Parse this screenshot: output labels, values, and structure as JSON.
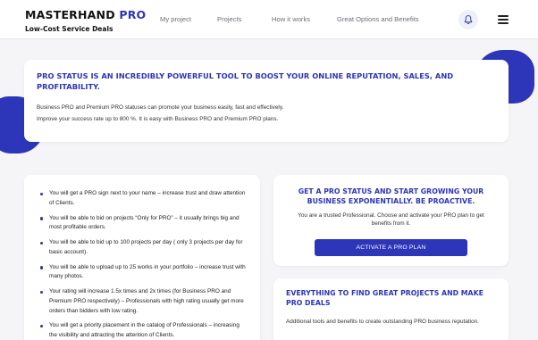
{
  "header": {
    "brand_name": "MASTERHAND",
    "brand_accent": "PRO",
    "brand_subtitle": "Low-Cost Service Deals",
    "nav": [
      {
        "label": "My project"
      },
      {
        "label": "Projects"
      },
      {
        "label": "How it works"
      },
      {
        "label": "Great Options and Benefits"
      }
    ],
    "icons": {
      "notifications": "bell-icon",
      "menu": "hamburger-menu-icon"
    }
  },
  "colors": {
    "accent": "#2d35b8",
    "background": "#f5f5f7",
    "card": "#ffffff"
  },
  "intro": {
    "title": "PRO STATUS IS AN INCREDIBLY POWERFUL TOOL TO BOOST YOUR ONLINE REPUTATION, SALES, AND PROFITABILITY.",
    "text1": "Business PRO and Premium PRO statuses can promote your business easily, fast and effectively.",
    "text2": "Improve your success rate up to 800 %. It is easy with Business PRO and Premium PRO plans."
  },
  "benefits": [
    "You will get a PRO sign next to your name – increase trust and draw attention of Clients.",
    "You will be able to bid on projects “Only for PRO” – it usually brings big and most profitable orders.",
    "You will be able to bid up to 100 projects per day ( only 3 projects per day for basic account).",
    "You will be able to upload up to 25 works in your portfolio – increase trust with many photos.",
    "Your rating will increase 1.5x times and 2x times (for Business PRO and Premium PRO respectively) – Professionals with high rating usually get more orders than bidders with low rating.",
    "You will get a priority placement in the catalog of Professionals – increasing the visibility and attracting the attention of Clients."
  ],
  "cta": {
    "title": "GET A PRO STATUS AND START GROWING YOUR BUSINESS EXPONENTIALLY. BE PROACTIVE.",
    "text": "You are a trusted Professional. Choose and activate your PRO plan to get benefits from it.",
    "button": "ACTIVATE A PRO PLAN"
  },
  "tools": {
    "title": "EVERYTHING TO FIND GREAT PROJECTS AND MAKE PRO DEALS",
    "text": "Additional tools and benefits to create outstanding PRO business reputation."
  }
}
